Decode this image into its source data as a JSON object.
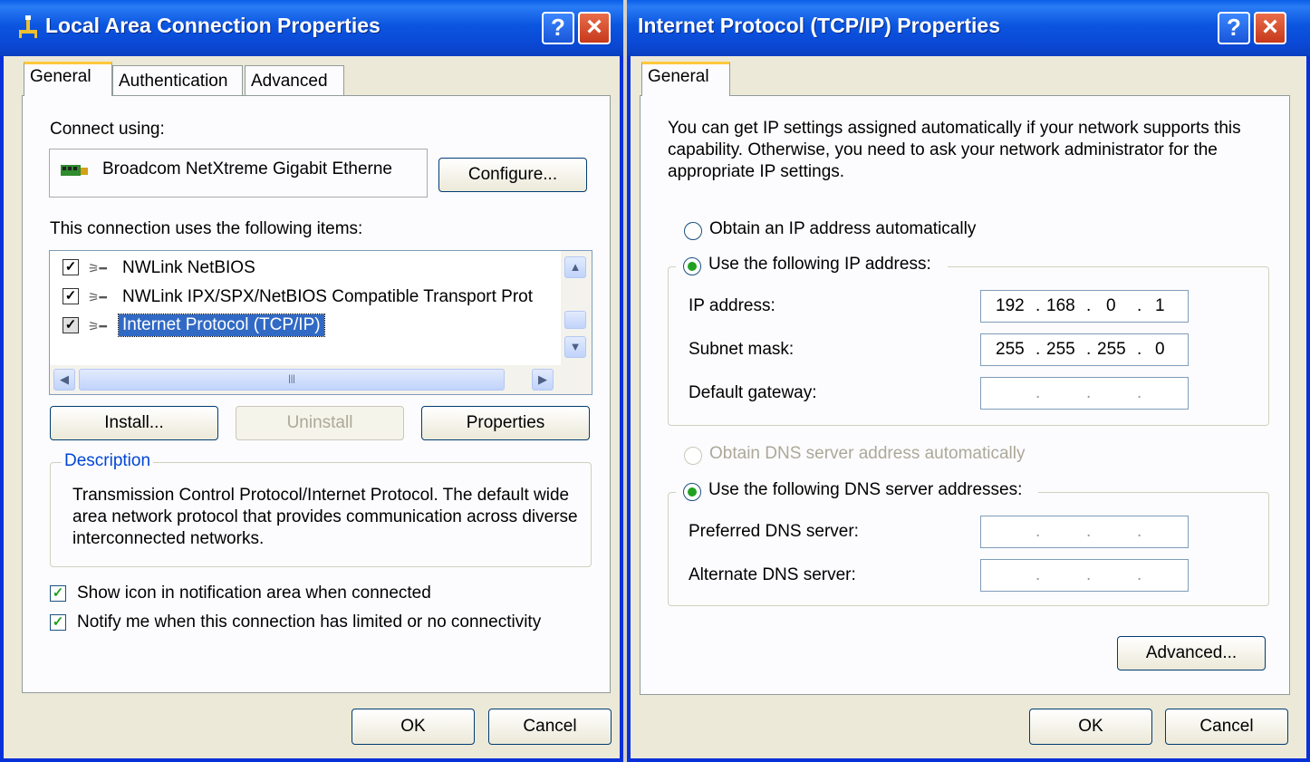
{
  "lan": {
    "title": "Local Area Connection Properties",
    "tabs": [
      "General",
      "Authentication",
      "Advanced"
    ],
    "connect_using_label": "Connect using:",
    "adapter_name": "Broadcom NetXtreme Gigabit Etherne",
    "configure_button": "Configure...",
    "items_label": "This connection uses the following items:",
    "items": [
      {
        "label": "NWLink NetBIOS",
        "checked": true
      },
      {
        "label": "NWLink IPX/SPX/NetBIOS Compatible Transport Prot",
        "checked": true
      },
      {
        "label": "Internet Protocol (TCP/IP)",
        "checked": true
      }
    ],
    "install_button": "Install...",
    "uninstall_button": "Uninstall",
    "properties_button": "Properties",
    "description_legend": "Description",
    "description_text": "Transmission Control Protocol/Internet Protocol. The default wide area network protocol that provides communication across diverse interconnected networks.",
    "show_icon_label": "Show icon in notification area when connected",
    "notify_label": "Notify me when this connection has limited or no connectivity",
    "ok_button": "OK",
    "cancel_button": "Cancel"
  },
  "tcpip": {
    "title": "Internet Protocol (TCP/IP) Properties",
    "tab": "General",
    "intro": "You can get IP settings assigned automatically if your network supports this capability. Otherwise, you need to ask your network administrator for the appropriate IP settings.",
    "obtain_ip_label": "Obtain an IP address automatically",
    "use_ip_label": "Use the following IP address:",
    "ip_address_label": "IP address:",
    "subnet_label": "Subnet mask:",
    "gateway_label": "Default gateway:",
    "ip_address": [
      "192",
      "168",
      "0",
      "1"
    ],
    "subnet_mask": [
      "255",
      "255",
      "255",
      "0"
    ],
    "obtain_dns_label": "Obtain DNS server address automatically",
    "use_dns_label": "Use the following DNS server addresses:",
    "preferred_dns_label": "Preferred DNS server:",
    "alternate_dns_label": "Alternate DNS server:",
    "advanced_button": "Advanced...",
    "ok_button": "OK",
    "cancel_button": "Cancel"
  },
  "titlebar_buttons": {
    "help": "?",
    "close": "×"
  }
}
